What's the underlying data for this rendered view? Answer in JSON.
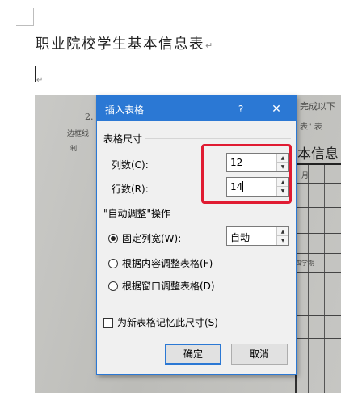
{
  "document": {
    "title": "职业院校学生基本信息表",
    "paragraph_mark": "↵"
  },
  "photo_background": {
    "snippets": [
      "2.",
      "完成以下",
      "边框线",
      "表\"  表",
      "制",
      "本信息",
      "月",
      "四学期"
    ]
  },
  "dialog": {
    "title": "插入表格",
    "help_label": "?",
    "close_label": "✕",
    "table_size_group": "表格尺寸",
    "columns_label": "列数(C):",
    "columns_value": "12",
    "rows_label": "行数(R):",
    "rows_value": "14",
    "autofit_group": "\"自动调整\"操作",
    "fixed_width_label": "固定列宽(W):",
    "fixed_width_value": "自动",
    "autofit_contents_label": "根据内容调整表格(F)",
    "autofit_window_label": "根据窗口调整表格(D)",
    "selected_option": "fixed_width",
    "remember_label": "为新表格记忆此尺寸(S)",
    "remember_checked": false,
    "ok_label": "确定",
    "cancel_label": "取消"
  },
  "colors": {
    "titlebar": "#2b78d4",
    "highlight": "#e01b32",
    "dialog_bg": "#f0f0f0"
  }
}
